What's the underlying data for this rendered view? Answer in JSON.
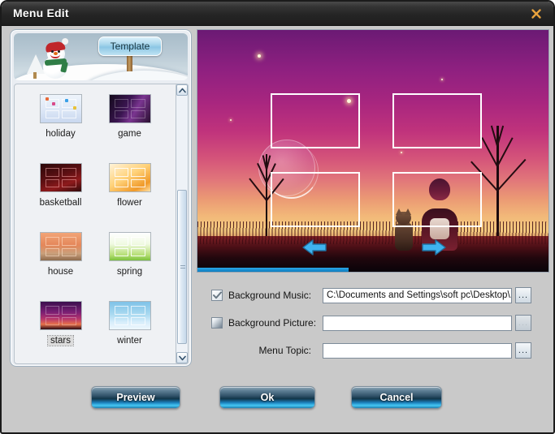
{
  "window": {
    "title": "Menu Edit",
    "close_icon": "close-icon",
    "background_color": "#c9c9c9",
    "titlebar_color": "#252525",
    "close_icon_color": "#e8a33d"
  },
  "left_panel": {
    "tab_label": "Template",
    "header_scene": "winter-snowman",
    "templates": [
      {
        "label": "holiday",
        "selected": false
      },
      {
        "label": "game",
        "selected": false
      },
      {
        "label": "basketball",
        "selected": false
      },
      {
        "label": "flower",
        "selected": false
      },
      {
        "label": "house",
        "selected": false
      },
      {
        "label": "spring",
        "selected": false
      },
      {
        "label": "stars",
        "selected": true
      },
      {
        "label": "winter",
        "selected": false
      }
    ],
    "scrollbar": {
      "up_icon": "chevron-up-icon",
      "down_icon": "chevron-down-icon",
      "grip_icon": "grip-icon"
    }
  },
  "preview": {
    "scene": "stars-sunset-girl-and-cat",
    "frame_count": 4,
    "prev_arrow_icon": "arrow-left-icon",
    "next_arrow_icon": "arrow-right-icon",
    "accent_color": "#2aa8e8"
  },
  "form": {
    "background_music": {
      "label": "Background Music:",
      "checked": true,
      "value": "C:\\Documents and Settings\\soft  pc\\Desktop\\...",
      "placeholder": "",
      "browse_label": "...",
      "browse_enabled": true
    },
    "background_picture": {
      "label": "Background Picture:",
      "checked": false,
      "value": "",
      "placeholder": "",
      "browse_label": "...",
      "browse_enabled": false
    },
    "menu_topic": {
      "label": "Menu Topic:",
      "value": "",
      "placeholder": "",
      "browse_label": "...",
      "browse_enabled": true
    }
  },
  "buttons": {
    "preview": "Preview",
    "ok": "Ok",
    "cancel": "Cancel"
  }
}
